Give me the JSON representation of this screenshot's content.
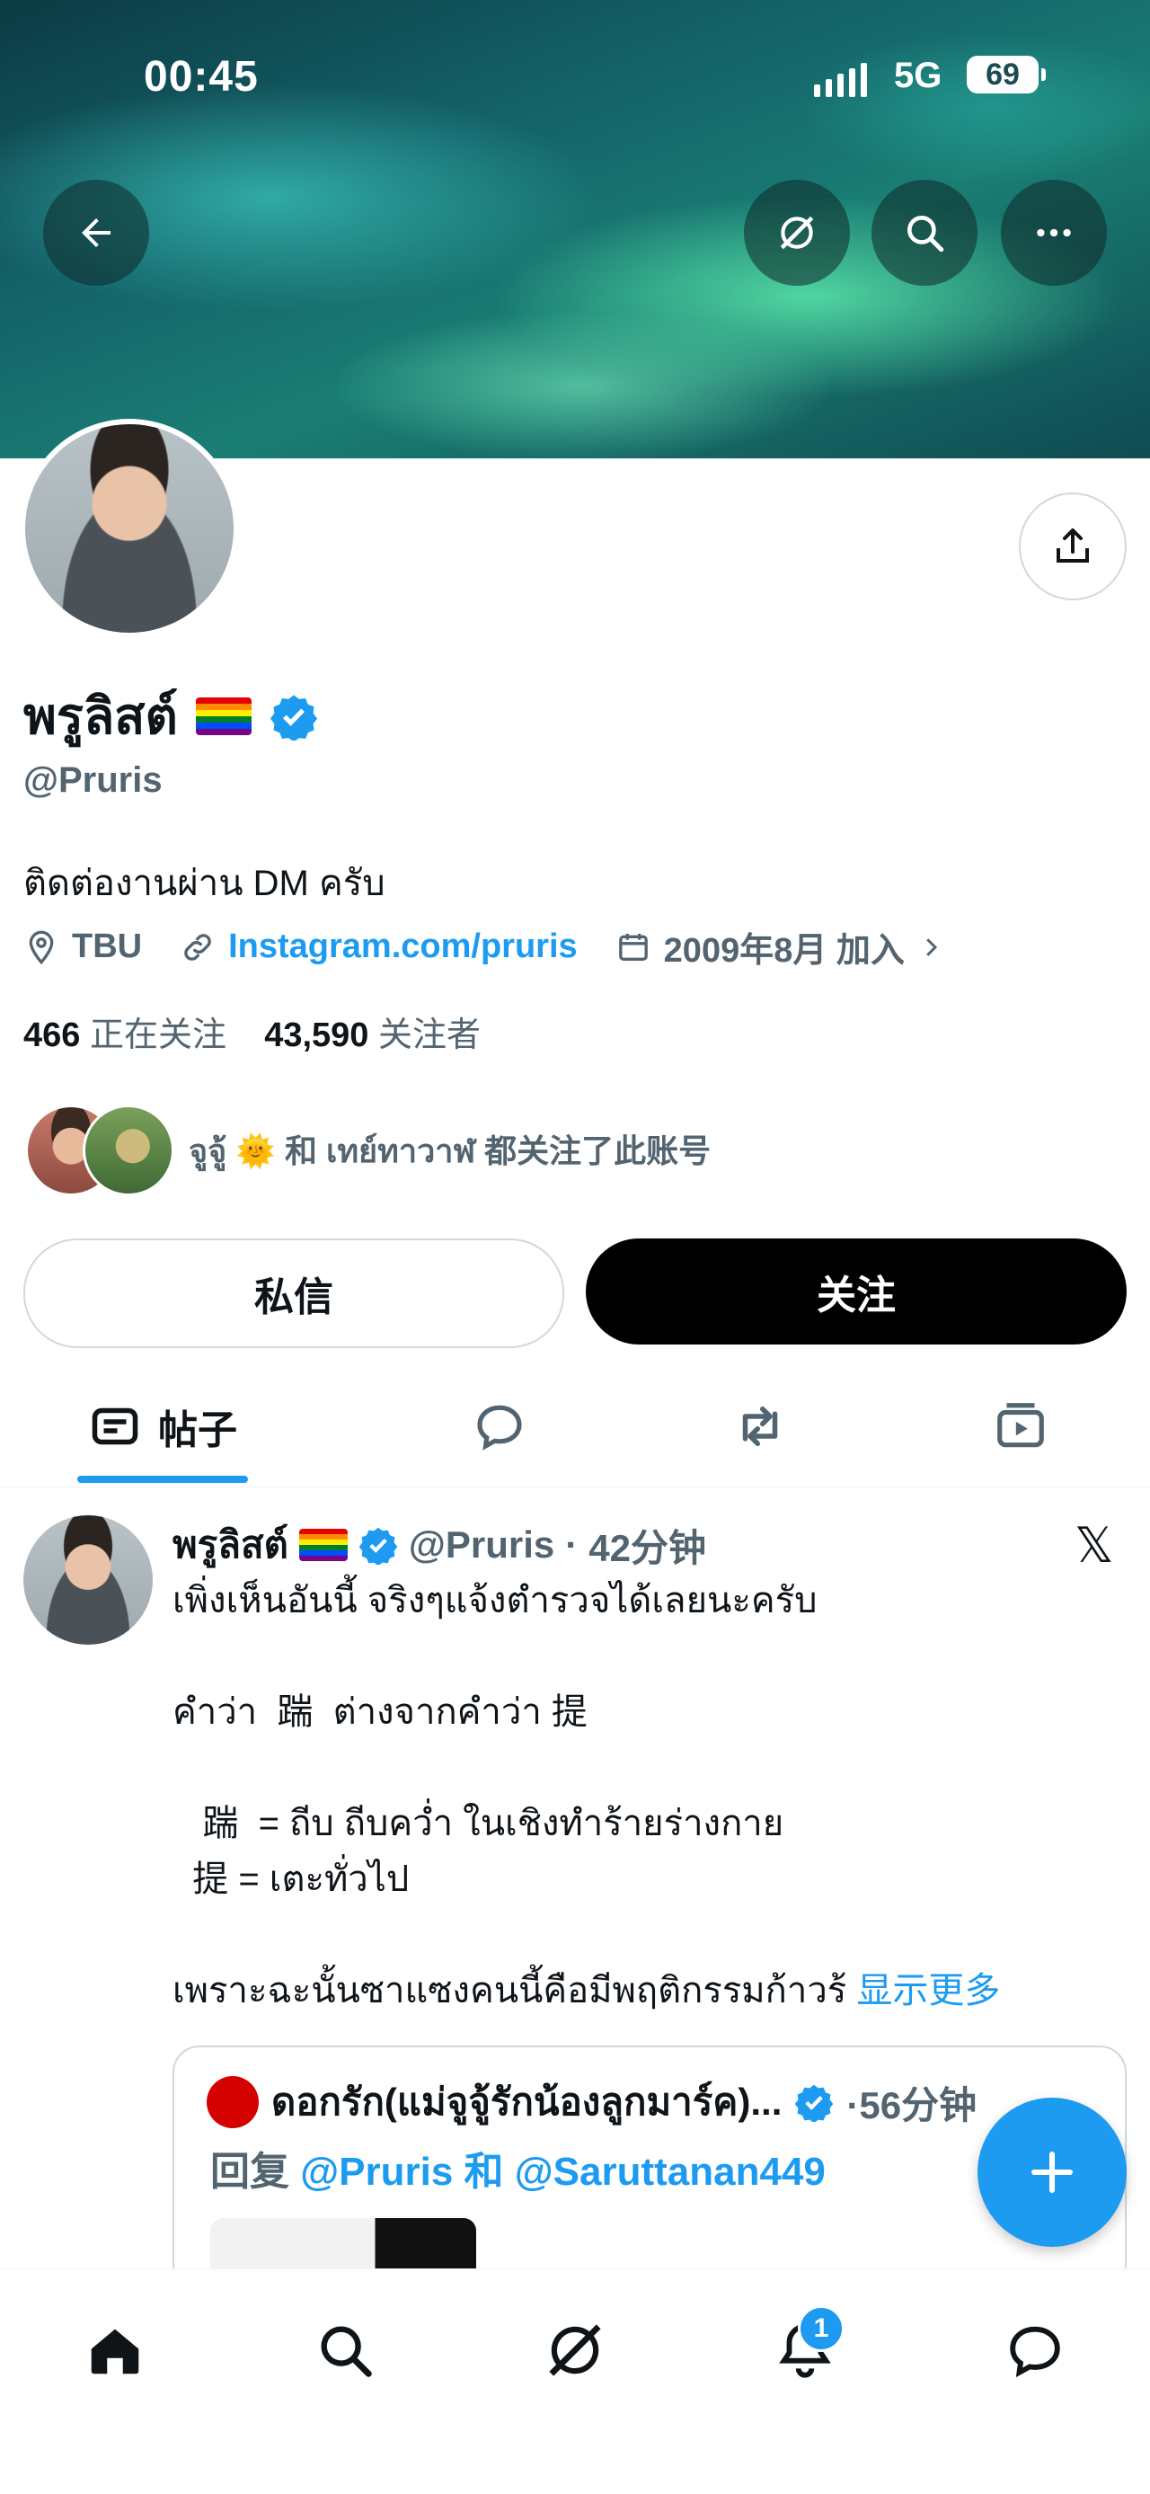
{
  "status_bar": {
    "time": "00:45",
    "network": "5G",
    "battery": "69"
  },
  "profile": {
    "display_name": "พรูลิสต์",
    "handle": "@Pruris",
    "bio": "ติดต่องานผ่าน DM ครับ",
    "location": "TBU",
    "website": "Instagram.com/pruris",
    "joined": "2009年8月 加入",
    "following_count": "466",
    "following_label": "正在关注",
    "followers_count": "43,590",
    "followers_label": "关注者",
    "followed_by": "จูจู้ 🌞 和 เทย์ทาวาฬ 都关注了此账号"
  },
  "actions": {
    "message_label": "私信",
    "follow_label": "关注"
  },
  "tabs": [
    {
      "label": "帖子",
      "icon": "posts-icon",
      "active": true
    },
    {
      "icon": "reply-bubble-icon"
    },
    {
      "icon": "repost-icon"
    },
    {
      "icon": "media-icon"
    }
  ],
  "post": {
    "author": "พรูลิสต์",
    "handle": "@Pruris",
    "time": "42分钟",
    "text": "เพิ่งเห็นอันนี้ จริงๆแจ้งตำรวจได้เลยนะครับ\n\nคำว่า  踹  ต่างจากคำว่า 提\n\n   踹  = ถีบ ถีบคว่ำ ในเชิงทำร้ายร่างกาย\n  提 = เตะทั่วไป\n\nเพราะฉะนั้นซาแซงคนนี้คือมีพฤติกรรมก้าวร้ ",
    "show_more": "显示更多",
    "quote": {
      "author": "ดอกรัก(แม่จูจู้รักน้องลูกมาร์ค)...",
      "time": "·56分钟",
      "reply_prefix": "回复",
      "reply_targets": "@Pruris 和 @Saruttanan449"
    }
  },
  "bottom_nav": {
    "notifications_badge": "1"
  },
  "colors": {
    "accent": "#1d9bf0",
    "text": "#0f1419",
    "muted": "#536471"
  }
}
